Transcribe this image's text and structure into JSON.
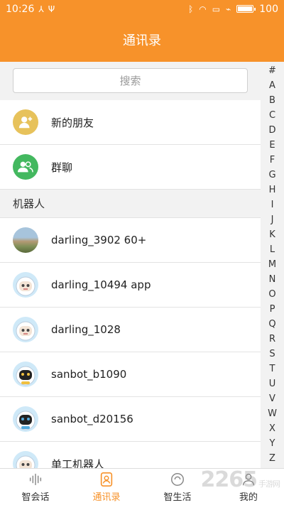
{
  "status": {
    "time": "10:26",
    "battery": "100"
  },
  "header": {
    "title": "通讯录"
  },
  "search": {
    "placeholder": "搜索"
  },
  "top_items": [
    {
      "label": "新的朋友",
      "icon": "new-friend-icon"
    },
    {
      "label": "群聊",
      "icon": "group-chat-icon"
    }
  ],
  "section_label": "机器人",
  "contacts": [
    {
      "name": "darling_3902 60+"
    },
    {
      "name": "darling_10494 app"
    },
    {
      "name": "darling_1028"
    },
    {
      "name": "sanbot_b1090"
    },
    {
      "name": "sanbot_d20156"
    },
    {
      "name": "单工机器人"
    }
  ],
  "index_letters": [
    "#",
    "A",
    "B",
    "C",
    "D",
    "E",
    "F",
    "G",
    "H",
    "I",
    "J",
    "K",
    "L",
    "M",
    "N",
    "O",
    "P",
    "Q",
    "R",
    "S",
    "T",
    "U",
    "V",
    "W",
    "X",
    "Y",
    "Z"
  ],
  "tabs": [
    {
      "label": "智会话",
      "icon": "voice-wave-icon",
      "active": false
    },
    {
      "label": "通讯录",
      "icon": "contacts-book-icon",
      "active": true
    },
    {
      "label": "智生活",
      "icon": "smart-life-icon",
      "active": false
    },
    {
      "label": "我的",
      "icon": "profile-icon",
      "active": false
    }
  ],
  "watermark": {
    "text": "2265",
    "suffix": "手游网"
  },
  "colors": {
    "accent": "#f7922a",
    "yellow_avatar": "#e7c25b",
    "green_avatar": "#43b85f"
  }
}
